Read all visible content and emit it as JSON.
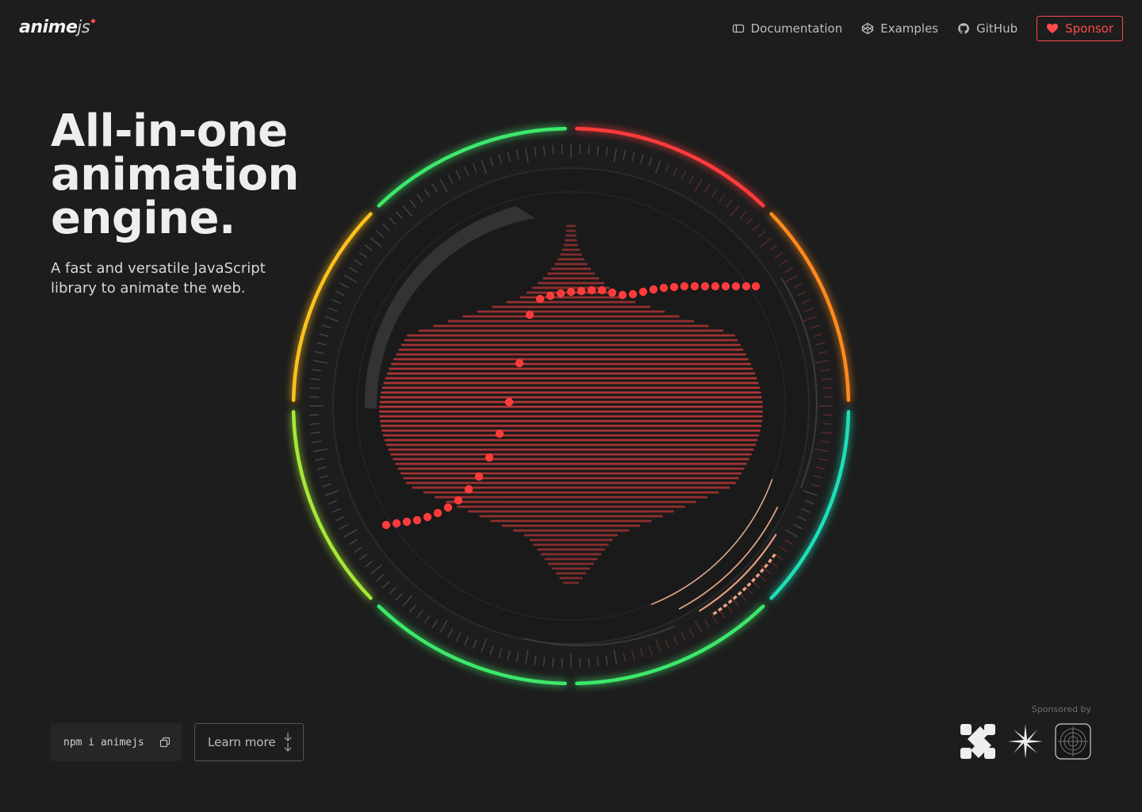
{
  "logo": {
    "brand_a": "anime",
    "brand_b": "js"
  },
  "nav": {
    "documentation": "Documentation",
    "examples": "Examples",
    "github": "GitHub",
    "sponsor": "Sponsor"
  },
  "hero": {
    "title_lines": [
      "All-in-one",
      "animation",
      "engine."
    ],
    "subtitle": "A fast and versatile JavaScript library to animate the web."
  },
  "actions": {
    "install_command": "npm i animejs",
    "learn_more": "Learn more"
  },
  "sponsors": {
    "label": "Sponsored by",
    "items": [
      "sponsor-logo-1",
      "sponsor-logo-2",
      "sponsor-logo-3"
    ]
  },
  "colors": {
    "background": "#1d1d1d",
    "accent": "#ff4b4b",
    "ring_segments": [
      "#ff3b3b",
      "#ff8a1f",
      "#1fe0b8",
      "#3ee86a",
      "#3ee86a",
      "#a5e838",
      "#ffc21f",
      "#3ee86a"
    ]
  }
}
